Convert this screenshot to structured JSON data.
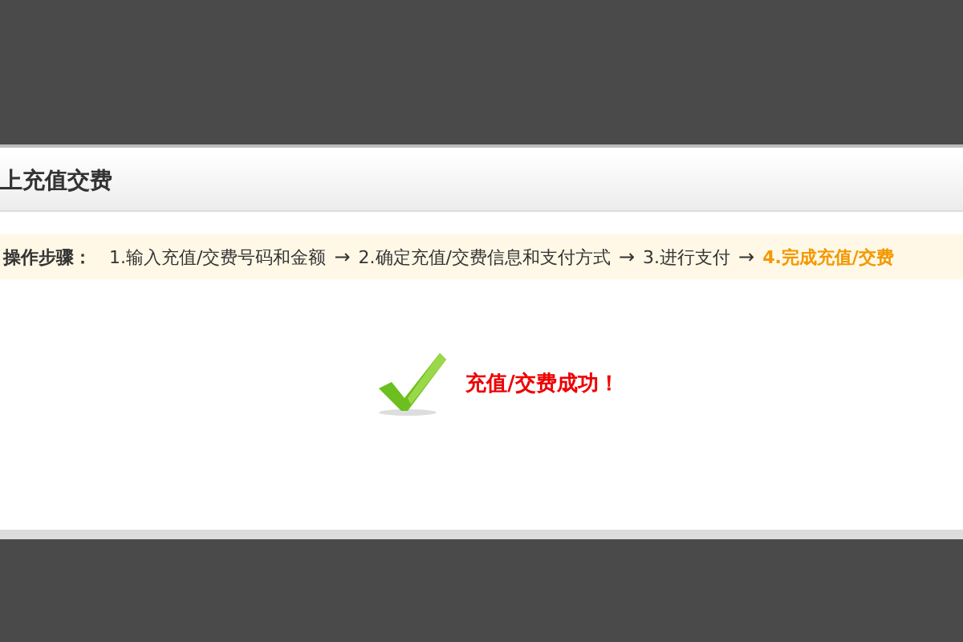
{
  "dialog": {
    "title": "上充值交费",
    "steps_label": "操作步骤：",
    "steps": [
      {
        "label": "1.输入充值/交费号码和金额",
        "selected": false
      },
      {
        "label": "2.确定充值/交费信息和支付方式",
        "selected": false
      },
      {
        "label": "3.进行支付",
        "selected": false
      },
      {
        "label": "4.完成充值/交费",
        "selected": true
      }
    ],
    "arrow": "→",
    "message": "充值/交费成功！"
  }
}
